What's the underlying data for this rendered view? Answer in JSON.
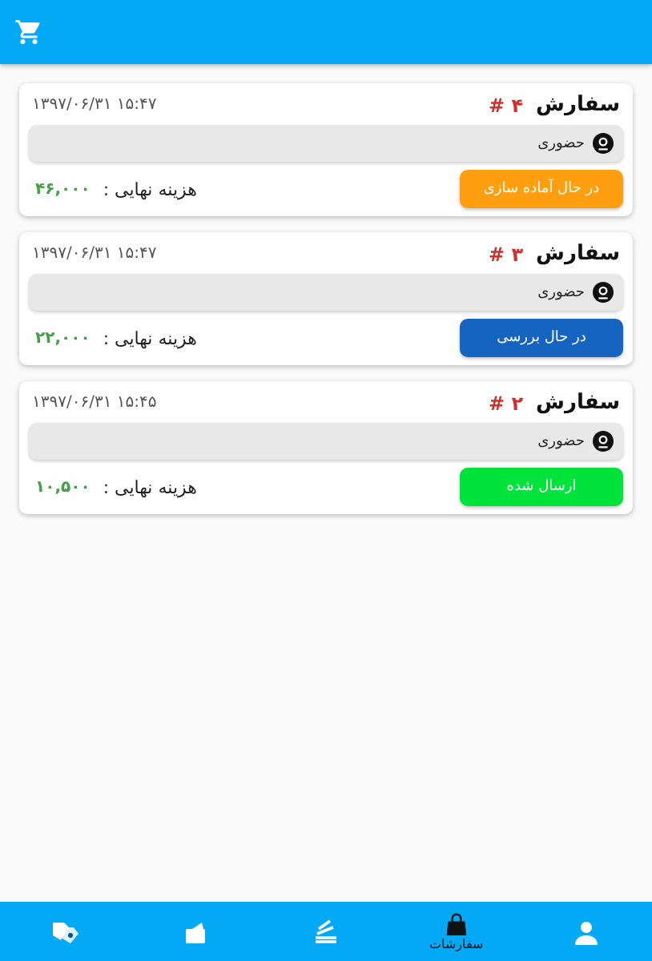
{
  "orders": [
    {
      "title": "سفارش",
      "number": "# ۴",
      "datetime": "۱۳۹۷/۰۶/۳۱ ۱۵:۴۷",
      "delivery": "حضوری",
      "status": "در حال آماده سازی",
      "color": "#ff9f0f",
      "cost_label": "هزینه نهایی :",
      "cost": "۴۶,۰۰۰"
    },
    {
      "title": "سفارش",
      "number": "# ۳",
      "datetime": "۱۳۹۷/۰۶/۳۱ ۱۵:۴۷",
      "delivery": "حضوری",
      "status": "در حال بررسی",
      "color": "#1565c0",
      "cost_label": "هزینه نهایی :",
      "cost": "۲۲,۰۰۰"
    },
    {
      "title": "سفارش",
      "number": "# ۲",
      "datetime": "۱۳۹۷/۰۶/۳۱ ۱۵:۴۵",
      "delivery": "حضوری",
      "status": "ارسال شده",
      "color": "#00e33a",
      "cost_label": "هزینه نهایی :",
      "cost": "۱۰,۵۰۰"
    }
  ],
  "bottom_nav": [
    {
      "kind": "profile",
      "selected": false
    },
    {
      "kind": "orders",
      "label": "سفارشات",
      "selected": true
    },
    {
      "kind": "payments",
      "selected": false
    },
    {
      "kind": "wallet",
      "selected": false
    },
    {
      "kind": "offers",
      "selected": false
    }
  ]
}
